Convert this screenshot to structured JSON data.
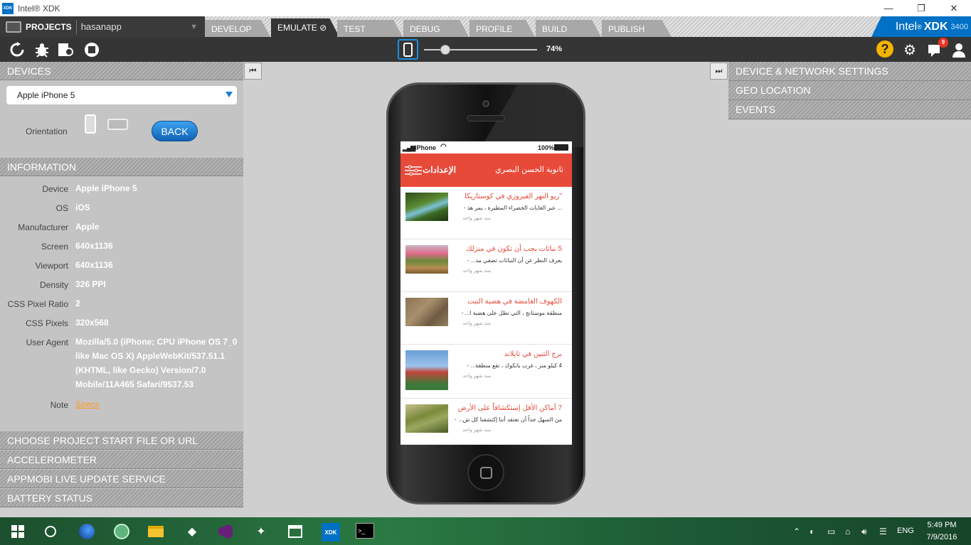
{
  "window": {
    "title": "Intel® XDK",
    "minimize": "—",
    "restore": "❐",
    "close": "✕"
  },
  "project": {
    "label": "PROJECTS",
    "name": "hasanapp"
  },
  "tabs": [
    "DEVELOP",
    "EMULATE",
    "TEST",
    "DEBUG",
    "PROFILE",
    "BUILD",
    "PUBLISH"
  ],
  "active_tab": "EMULATE",
  "brand": {
    "intel": "Intel",
    "xdk": "XDK",
    "version": "3400"
  },
  "toolbar": {
    "zoom": "74%",
    "zoom_level": 0.74,
    "help": "?",
    "notifications": "9"
  },
  "left_panel": {
    "devices_header": "DEVICES",
    "device_selected": "Apple iPhone 5",
    "orientation_label": "Orientation",
    "back_button": "BACK",
    "information_header": "INFORMATION",
    "info": [
      {
        "key": "Device",
        "value": "Apple iPhone 5"
      },
      {
        "key": "OS",
        "value": "iOS"
      },
      {
        "key": "Manufacturer",
        "value": "Apple"
      },
      {
        "key": "Screen",
        "value": "640x1136"
      },
      {
        "key": "Viewport",
        "value": "640x1136"
      },
      {
        "key": "Density",
        "value": "326 PPI"
      },
      {
        "key": "CSS Pixel Ratio",
        "value": "2"
      },
      {
        "key": "CSS Pixels",
        "value": "320x568"
      },
      {
        "key": "User Agent",
        "value": "Mozilla/5.0 (iPhone; CPU iPhone OS 7_0 like Mac OS X) AppleWebKit/537.51.1 (KHTML, like Gecko) Version/7.0 Mobile/11A465 Safari/9537.53"
      },
      {
        "key": "Note",
        "value": "Specs"
      }
    ],
    "sections": [
      "CHOOSE PROJECT START FILE OR URL",
      "ACCELEROMETER",
      "APPMOBI LIVE UPDATE SERVICE",
      "BATTERY STATUS"
    ]
  },
  "right_panel": {
    "sections": [
      "DEVICE & NETWORK SETTINGS",
      "GEO LOCATION",
      "EVENTS"
    ]
  },
  "phone": {
    "status": {
      "carrier": "iPhone",
      "battery": "100%"
    },
    "appbar": {
      "settings": "الإعدادات",
      "title": "ثانوية الحسن البصري"
    },
    "articles": [
      {
        "title": "\"ريو النهر الفيروزي في كوستاريكا",
        "desc": "... عبر الغابات الخضراء المطيرة ، يمر هذ -",
        "time": "منذ شهر واحد"
      },
      {
        "title": "5 نباتات يجب أن تكون في منزلك",
        "desc": "يعرف النظر عن أن النباتات تضفي مد... -",
        "time": "منذ شهر واحد"
      },
      {
        "title": "الكهوف الغامضة في هضبة التبت",
        "desc": "منطقة موستانج ، التي تطل على هضبة ا... -",
        "time": "منذ شهر واحد"
      },
      {
        "title": "برج التنين في تايلاند",
        "desc": "4 كيلو متر ، غرب بانكوك ، تقع منطقة... -",
        "time": "منذ شهر واحد"
      },
      {
        "title": "7 أماكن الأقل إستكشافاً على الأرض",
        "desc": "من السهل جداً أن نعتقد أننا إكتشفنا كل ش... -",
        "time": "منذ شهر واحد"
      }
    ]
  },
  "taskbar": {
    "lang": "ENG",
    "time": "5:49 PM",
    "date": "7/9/2016"
  },
  "colors": {
    "accent": "#0071c5",
    "app_red": "#e84a3a",
    "toolbar": "#353535"
  }
}
